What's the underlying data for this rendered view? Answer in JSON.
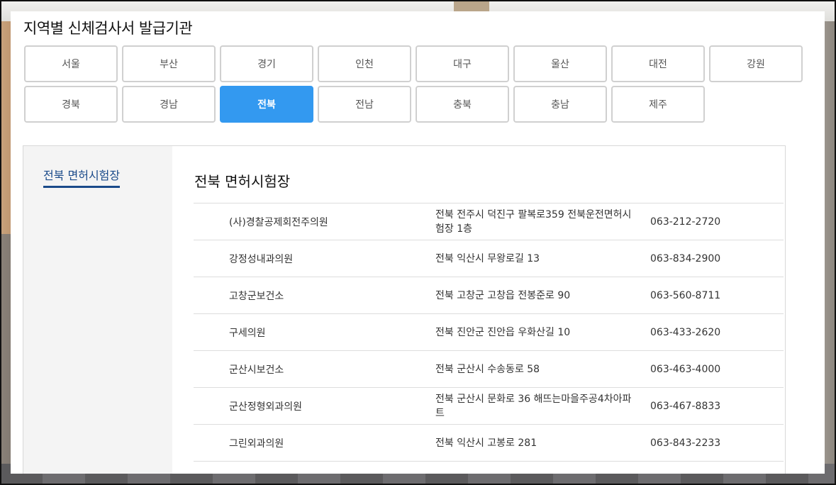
{
  "page_title": "지역별 신체검사서 발급기관",
  "regions": [
    "서울",
    "부산",
    "경기",
    "인천",
    "대구",
    "울산",
    "대전",
    "강원",
    "경북",
    "경남",
    "전북",
    "전남",
    "충북",
    "충남",
    "제주"
  ],
  "active_region": "전북",
  "side_menu": {
    "item": "전북 면허시험장"
  },
  "section_title": "전북 면허시험장",
  "institutions": [
    {
      "name": "(사)경찰공제회전주의원",
      "address": "전북 전주시 덕진구 팔복로359 전북운전면허시험장 1층",
      "phone": "063-212-2720"
    },
    {
      "name": "강정성내과의원",
      "address": "전북 익산시 무왕로길 13",
      "phone": "063-834-2900"
    },
    {
      "name": "고창군보건소",
      "address": "전북 고창군 고창읍 전봉준로 90",
      "phone": "063-560-8711"
    },
    {
      "name": "구세의원",
      "address": "전북 진안군 진안읍 우화산길 10",
      "phone": "063-433-2620"
    },
    {
      "name": "군산시보건소",
      "address": "전북 군산시 수송동로 58",
      "phone": "063-463-4000"
    },
    {
      "name": "군산정형외과의원",
      "address": "전북 군산시 문화로 36 해뜨는마을주공4차아파트",
      "phone": "063-467-8833"
    },
    {
      "name": "그린외과의원",
      "address": "전북 익산시 고봉로 281",
      "phone": "063-843-2233"
    }
  ]
}
